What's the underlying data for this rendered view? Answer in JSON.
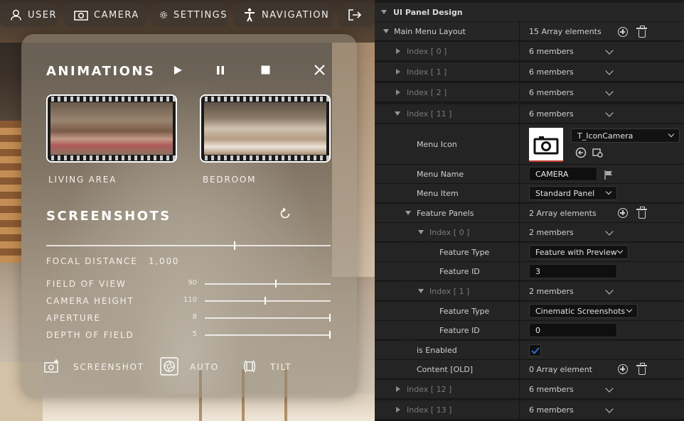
{
  "left_panel": {
    "nav": [
      {
        "icon": "user-icon",
        "label": "USER"
      },
      {
        "icon": "camera-icon",
        "label": "CAMERA"
      },
      {
        "icon": "gear-icon",
        "label": "SETTINGS"
      },
      {
        "icon": "navigation-person-icon",
        "label": "NAVIGATION"
      },
      {
        "icon": "exit-icon",
        "label": ""
      }
    ],
    "animations": {
      "title": "ANIMATIONS",
      "controls": [
        "play-icon",
        "pause-icon",
        "stop-icon",
        "close-icon"
      ],
      "thumbnails": [
        {
          "label": "LIVING AREA"
        },
        {
          "label": "BEDROOM"
        }
      ]
    },
    "screenshots": {
      "title": "SCREENSHOTS",
      "reset_icon": "reset-icon",
      "focal_distance_label": "FOCAL DISTANCE",
      "focal_distance_value": "1,000",
      "focal_slider_fraction": 0.6,
      "sliders": [
        {
          "label": "FIELD OF VIEW",
          "value": "90",
          "fraction": 0.57
        },
        {
          "label": "CAMERA HEIGHT",
          "value": "110",
          "fraction": 0.5
        },
        {
          "label": "APERTURE",
          "value": "8",
          "fraction": 1.0
        },
        {
          "label": "DEPTH OF FIELD",
          "value": "5",
          "fraction": 1.0
        }
      ],
      "actions": [
        {
          "icon": "add-photo-icon",
          "label": "SCREENSHOT"
        },
        {
          "icon": "aperture-icon",
          "label": "AUTO"
        },
        {
          "icon": "tilt-icon",
          "label": "TILT"
        }
      ]
    }
  },
  "details": {
    "section_title": "UI Panel Design",
    "main_menu_layout": {
      "label": "Main Menu Layout",
      "value": "15 Array elements"
    },
    "rows": {
      "idx0": {
        "label": "Index [ 0 ]",
        "value": "6 members"
      },
      "idx1": {
        "label": "Index [ 1 ]",
        "value": "6 members"
      },
      "idx2": {
        "label": "Index [ 2 ]",
        "value": "6 members"
      },
      "idx11": {
        "label": "Index [ 11 ]",
        "value": "6 members"
      },
      "menu_icon": {
        "label": "Menu Icon",
        "asset": "T_IconCamera"
      },
      "menu_name": {
        "label": "Menu Name",
        "value": "CAMERA"
      },
      "menu_item": {
        "label": "Menu Item",
        "value": "Standard Panel"
      },
      "feature_panels": {
        "label": "Feature Panels",
        "value": "2 Array elements"
      },
      "fp0": {
        "label": "Index [ 0 ]",
        "value": "2 members"
      },
      "fp0_type": {
        "label": "Feature Type",
        "value": "Feature with Preview"
      },
      "fp0_id": {
        "label": "Feature ID",
        "value": "3"
      },
      "fp1": {
        "label": "Index [ 1 ]",
        "value": "2 members"
      },
      "fp1_type": {
        "label": "Feature Type",
        "value": "Cinematic Screenshots"
      },
      "fp1_id": {
        "label": "Feature ID",
        "value": "0"
      },
      "is_enabled": {
        "label": "is Enabled",
        "checked": true
      },
      "content_old": {
        "label": "Content [OLD]",
        "value": "0 Array element"
      },
      "idx12": {
        "label": "Index [ 12 ]",
        "value": "6 members"
      },
      "idx13": {
        "label": "Index [ 13 ]",
        "value": "6 members"
      }
    }
  },
  "colors": {
    "accent_check": "#2b6fd6",
    "panel_bg": "#242424"
  }
}
